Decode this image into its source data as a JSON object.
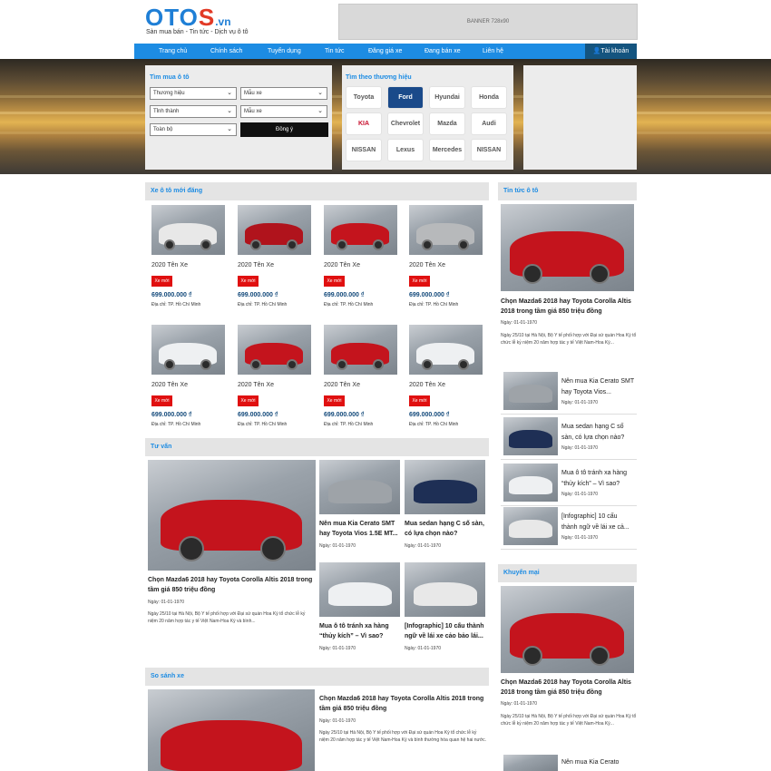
{
  "header": {
    "logo_main": "OTO",
    "logo_s": "S",
    "logo_tld": ".vn",
    "tagline": "Sàn mua bán - Tin tức - Dịch vụ ô tô",
    "banner_text": "BANNER 728x90"
  },
  "nav": {
    "items": [
      "Trang chủ",
      "Chính sách",
      "Tuyển dụng",
      "Tin tức",
      "Đăng giá xe",
      "Đang bán xe",
      "Liên hệ"
    ],
    "account": "Tài khoản"
  },
  "search": {
    "title": "Tìm mua ô tô",
    "brand_select": "Thương hiệu",
    "model_select": "Mẫu xe",
    "city_select": "Tỉnh thành",
    "model_select2": "Mẫu xe",
    "all_select": "Toàn bộ",
    "agree_button": "Đồng ý"
  },
  "brand_finder": {
    "title": "Tìm theo thương hiệu",
    "brands": [
      "Toyota",
      "Ford",
      "Hyundai",
      "Honda",
      "KIA",
      "Chevrolet",
      "Mazda",
      "Audi",
      "NISSAN",
      "Lexus",
      "Mercedes",
      "NISSAN"
    ]
  },
  "new_cars": {
    "title": "Xe ô tô mới đăng",
    "cards": [
      {
        "name": "2020 Tên Xe",
        "badge": "Xe mới",
        "price": "699.000.000 ₫",
        "address": "Địa chỉ: TP. Hồ Chí Minh",
        "color": "#e8e8e8"
      },
      {
        "name": "2020 Tên Xe",
        "badge": "Xe mới",
        "price": "699.000.000 ₫",
        "address": "Địa chỉ: TP. Hồ Chí Minh",
        "color": "#b0131c"
      },
      {
        "name": "2020 Tên Xe",
        "badge": "Xe mới",
        "price": "699.000.000 ₫",
        "address": "Địa chỉ: TP. Hồ Chí Minh",
        "color": "#c4141d"
      },
      {
        "name": "2020 Tên Xe",
        "badge": "Xe mới",
        "price": "699.000.000 ₫",
        "address": "Địa chỉ: TP. Hồ Chí Minh",
        "color": "#b7b9bb"
      },
      {
        "name": "2020 Tên Xe",
        "badge": "Xe mới",
        "price": "699.000.000 ₫",
        "address": "Địa chỉ: TP. Hồ Chí Minh",
        "color": "#eef0f2"
      },
      {
        "name": "2020 Tên Xe",
        "badge": "Xe mới",
        "price": "699.000.000 ₫",
        "address": "Địa chỉ: TP. Hồ Chí Minh",
        "color": "#c4141d"
      },
      {
        "name": "2020 Tên Xe",
        "badge": "Xe mới",
        "price": "699.000.000 ₫",
        "address": "Địa chỉ: TP. Hồ Chí Minh",
        "color": "#c4141d"
      },
      {
        "name": "2020 Tên Xe",
        "badge": "Xe mới",
        "price": "699.000.000 ₫",
        "address": "Địa chỉ: TP. Hồ Chí Minh",
        "color": "#eef0f2"
      }
    ]
  },
  "advice": {
    "title": "Tư vấn",
    "main": {
      "title": "Chọn Mazda6 2018 hay Toyota Corolla Altis 2018 trong tầm giá 850 triệu đồng",
      "date": "Ngày: 01-01-1970",
      "excerpt": "Ngày 25/10 tại Hà Nội, Bộ Y tế phối hợp với Đại sứ quán Hoa Kỳ tổ chức lễ kỷ niệm 20 năm hợp tác y tế Việt Nam-Hoa Kỳ và bình..."
    },
    "items": [
      {
        "title": "Nên mua Kia Cerato SMT hay Toyota Vios 1.5E MT...",
        "date": "Ngày: 01-01-1970",
        "color": "#9ea3a8"
      },
      {
        "title": "Mua sedan hạng C số sàn, có lựa chọn nào?",
        "date": "Ngày: 01-01-1970",
        "color": "#1e2f55"
      },
      {
        "title": "Mua ô tô tránh xa hàng “thủy kích” – Vì sao?",
        "date": "Ngày: 01-01-1970",
        "color": "#eef0f2"
      },
      {
        "title": "[Infographic] 10 cấu thành ngữ về lái xe cảo bảo lái...",
        "date": "Ngày: 01-01-1970",
        "color": "#e8e8e8"
      }
    ]
  },
  "compare": {
    "title": "So sánh xe",
    "main": {
      "title": "Chọn Mazda6 2018 hay Toyota Corolla Altis 2018 trong tầm giá 850 triệu đồng",
      "date": "Ngày: 01-01-1970",
      "excerpt": "Ngày 25/10 tại Hà Nội, Bộ Y tế phối hợp với Đại sứ quán Hoa Kỳ tổ chức lễ kỷ niệm 20 năm hợp tác y tế Việt Nam-Hoa Kỳ và bình thường hóa quan hệ hai nước."
    }
  },
  "news": {
    "title": "Tin tức ô tô",
    "main": {
      "title": "Chọn Mazda6 2018 hay Toyota Corolla Altis 2018 trong tầm giá 850 triệu đồng",
      "date": "Ngày: 01-01-1970",
      "excerpt": "Ngày 25/10 tại Hà Nội, Bộ Y tế phối hợp với Đại sứ quán Hoa Kỳ tổ chức lễ kỷ niệm 20 năm hợp tác y tế Việt Nam-Hoa Kỳ..."
    },
    "items": [
      {
        "title": "Nên mua Kia Cerato SMT hay Toyota Vios...",
        "date": "Ngày: 01-01-1970",
        "color": "#9ea3a8"
      },
      {
        "title": "Mua sedan hạng C số sàn, có lựa chọn nào?",
        "date": "Ngày: 01-01-1970",
        "color": "#1e2f55"
      },
      {
        "title": "Mua ô tô tránh xa hàng “thủy kích” – Vì sao?",
        "date": "Ngày: 01-01-1970",
        "color": "#eef0f2"
      },
      {
        "title": "[Infographic] 10 cấu thành ngữ về lái xe cả...",
        "date": "Ngày: 01-01-1970",
        "color": "#e8e8e8"
      }
    ]
  },
  "promo": {
    "title": "Khuyến mại",
    "main": {
      "title": "Chọn Mazda6 2018 hay Toyota Corolla Altis 2018 trong tầm giá 850 triệu đồng",
      "date": "Ngày: 01-01-1970",
      "excerpt": "Ngày 25/10 tại Hà Nội, Bộ Y tế phối hợp với Đại sứ quán Hoa Kỳ tổ chức lễ kỷ niệm 20 năm hợp tác y tế Việt Nam-Hoa Kỳ..."
    },
    "next_item": "Nên mua Kia Cerato"
  },
  "colors": {
    "primary": "#1d8ce3",
    "account_bg": "#14547f",
    "badge_red": "#e01010",
    "price": "#12497a"
  }
}
